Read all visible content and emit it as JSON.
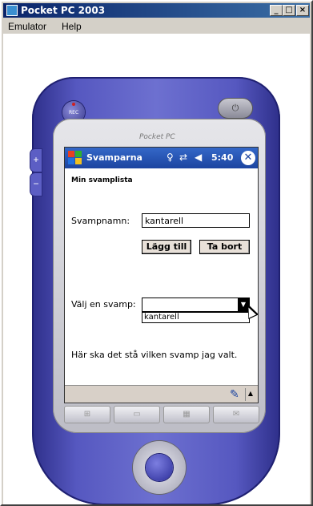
{
  "window": {
    "title": "Pocket PC 2003",
    "minimize": "_",
    "maximize": "□",
    "close": "×"
  },
  "menu": [
    "Emulator",
    "Help"
  ],
  "device": {
    "brand": "Pocket PC",
    "rec_label": "REC"
  },
  "device_screen": {
    "app_title": "Svamparna",
    "time": "5:40",
    "ok": "✕",
    "heading": "Min svamplista",
    "name_label": "Svampnamn:",
    "name_value": "kantarell",
    "add_button": "Lägg till",
    "remove_button": "Ta bort",
    "select_label": "Välj en svamp:",
    "select_value": "",
    "dropdown_items": [
      "kantarell"
    ],
    "info_text": "Här ska det stå vilken svamp jag valt."
  },
  "icons": {
    "start": "windows-flag-icon",
    "connectivity": "connectivity-icon",
    "sync": "sync-arrows-icon",
    "volume": "speaker-icon",
    "pen": "pen-icon",
    "sip": "sip-arrow-icon"
  }
}
